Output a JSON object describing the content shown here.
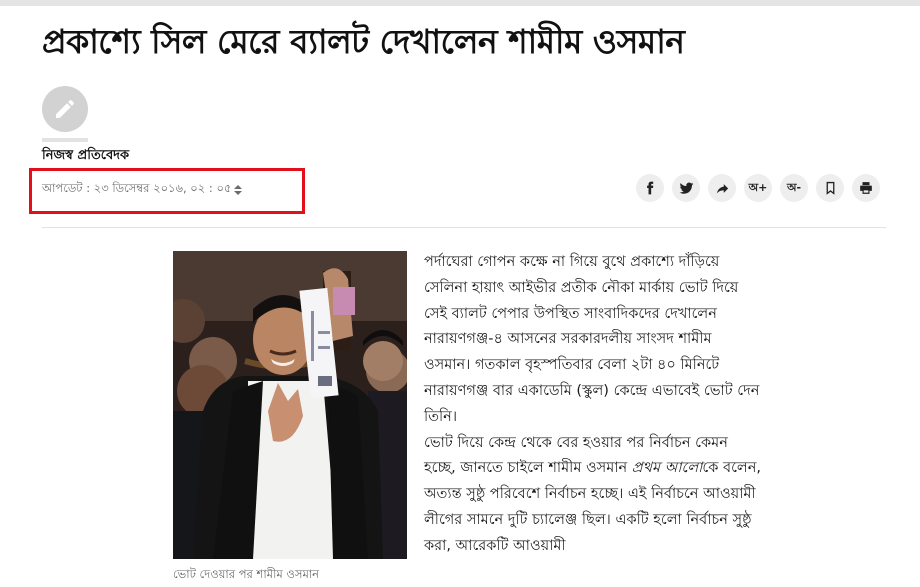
{
  "article": {
    "headline": "প্রকাশ্যে সিল মেরে ব্যালট দেখালেন শামীম ওসমান",
    "author": "নিজস্ব প্রতিবেদক",
    "updated": "আপডেট : ২৩ ডিসেম্বর ২০১৬, ০২ : ০৫",
    "image_caption": "ভোট দেওয়ার পর শামীম ওসমান",
    "paragraph1": "পর্দাঘেরা গোপন কক্ষে না গিয়ে বুথে প্রকাশ্যে দাঁড়িয়ে সেলিনা হায়াৎ আইভীর প্রতীক নৌকা মার্কায় ভোট দিয়ে সেই ব্যালট পেপার উপস্থিত সাংবাদিকদের দেখালেন নারায়ণগঞ্জ-৪ আসনের সরকারদলীয় সাংসদ শামীম ওসমান। গতকাল বৃহস্পতিবার বেলা ২টা ৪০ মিনিটে নারায়ণগঞ্জ বার একাডেমি (স্কুল) কেন্দ্রে এভাবেই ভোট দেন তিনি।",
    "paragraph2_before": "ভোট দিয়ে কেন্দ্র থেকে বের হওয়ার পর নির্বাচন কেমন হচ্ছে, জানতে চাইলে শামীম ওসমান ",
    "paragraph2_italic": "প্রথম আলো",
    "paragraph2_after": "কে বলেন, অত্যন্ত সুষ্ঠু পরিবেশে নির্বাচন হচ্ছে। এই নির্বাচনে আওয়ামী লীগের সামনে দুটি চ্যালেঞ্জ ছিল। একটি হলো নির্বাচন সুষ্ঠু করা, আরেকটি আওয়ামী"
  },
  "share": {
    "font_increase": "অ+",
    "font_decrease": "অ-",
    "icons": [
      "facebook-icon",
      "twitter-icon",
      "share-icon",
      "font-increase",
      "font-decrease",
      "bookmark-icon",
      "print-icon"
    ]
  },
  "colors": {
    "highlight_border": "#e3101c",
    "button_bg": "#eeeeee",
    "meta_text": "#6b6b6b"
  }
}
